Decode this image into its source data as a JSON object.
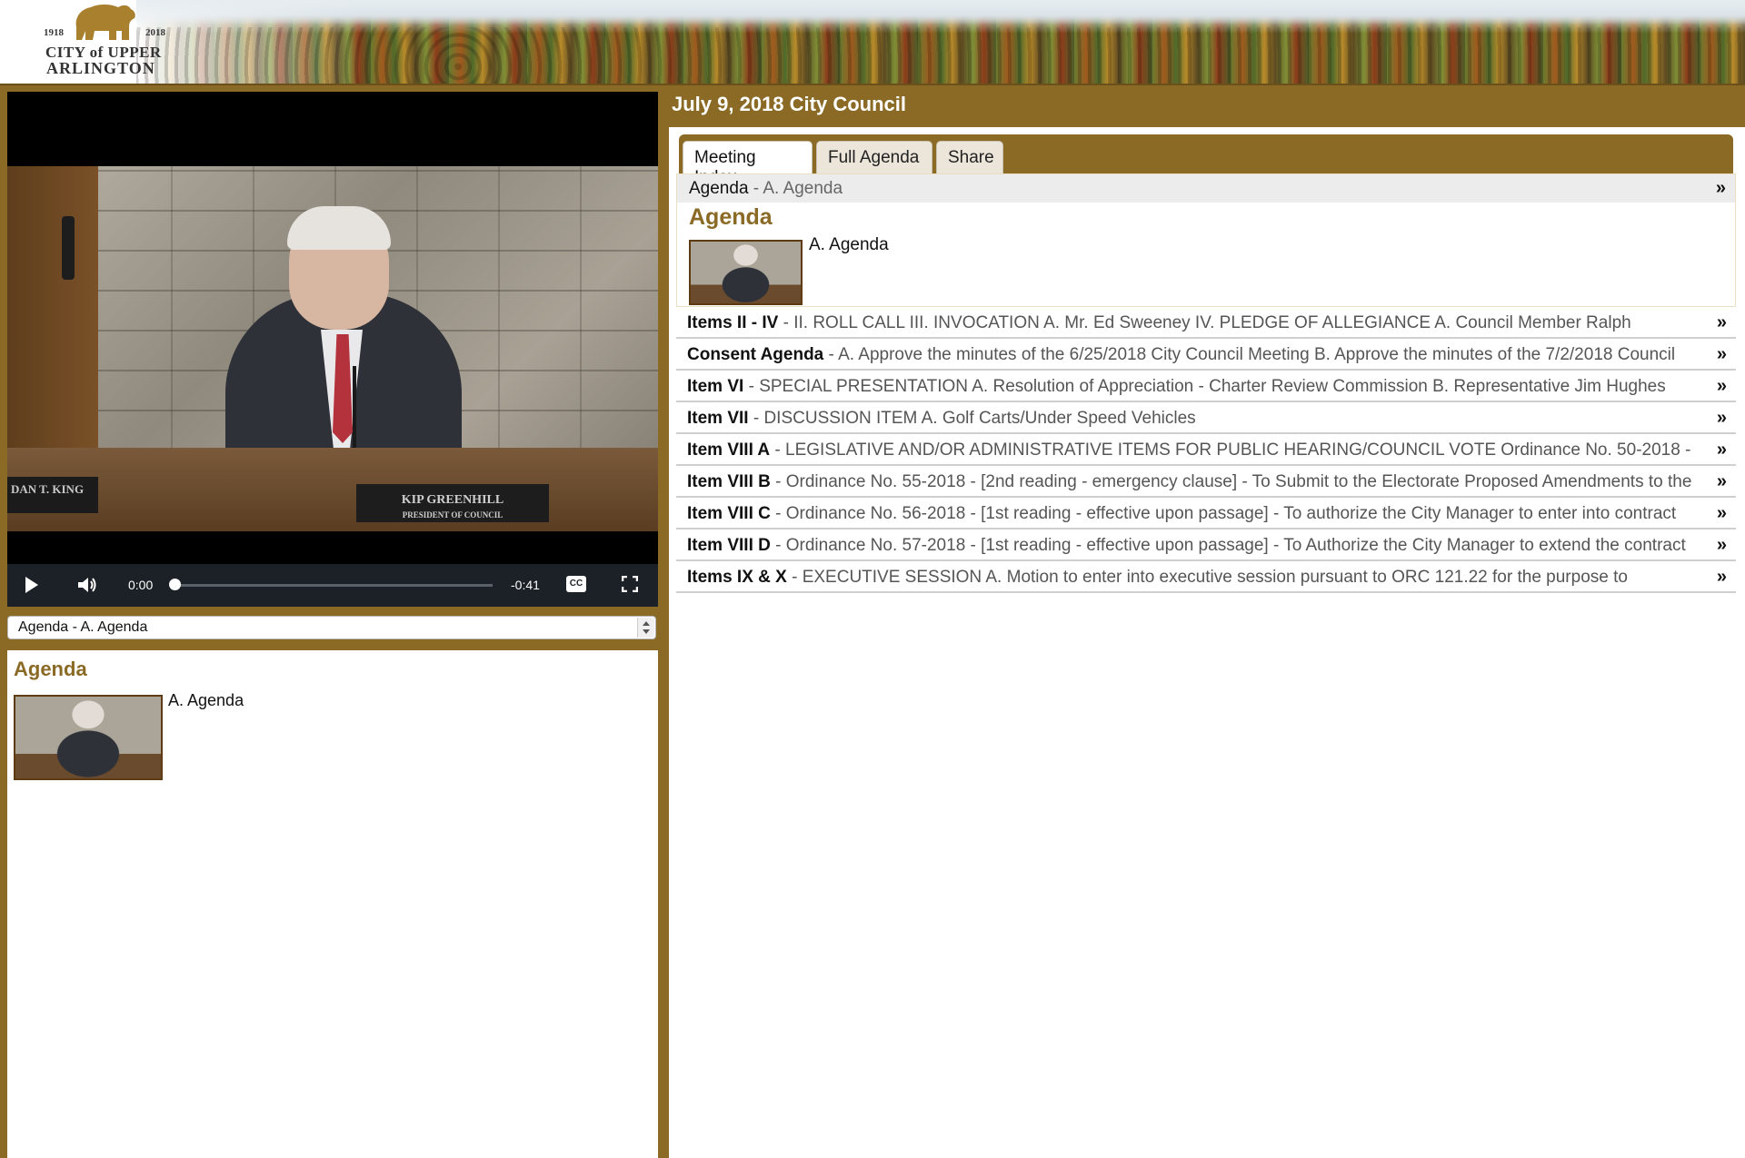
{
  "header": {
    "logo_year_start": "1918",
    "logo_year_end": "2018",
    "logo_line1": "CITY of UPPER",
    "logo_line2": "ARLINGTON"
  },
  "player": {
    "nameplate_left": "DAN T. KING",
    "nameplate_right": "KIP GREENHILL",
    "nameplate_right_sub": "PRESIDENT OF COUNCIL",
    "time_current": "0:00",
    "time_remaining": "-0:41",
    "cc_label": "CC",
    "progress": 0
  },
  "chapter_select": {
    "value": "Agenda - A. Agenda"
  },
  "left_detail": {
    "title": "Agenda",
    "label": "A. Agenda"
  },
  "meeting": {
    "title": "July 9, 2018 City Council"
  },
  "tabs": [
    {
      "label": "Meeting Index",
      "active": true
    },
    {
      "label": "Full Agenda",
      "active": false
    },
    {
      "label": "Share",
      "active": false
    }
  ],
  "active_item": {
    "head_title": "Agenda",
    "head_desc": " - A. Agenda",
    "arrow": "»",
    "title": "Agenda",
    "label": "A. Agenda"
  },
  "index_items": [
    {
      "title": "Items II - IV",
      "desc": " - II. ROLL CALL III. INVOCATION A. Mr. Ed Sweeney IV. PLEDGE OF ALLEGIANCE A. Council Member Ralph",
      "arrow": "»"
    },
    {
      "title": "Consent Agenda",
      "desc": " - A. Approve the minutes of the 6/25/2018 City Council Meeting B. Approve the minutes of the 7/2/2018 Council",
      "arrow": "»"
    },
    {
      "title": "Item VI",
      "desc": " - SPECIAL PRESENTATION A. Resolution of Appreciation - Charter Review Commission B. Representative Jim Hughes",
      "arrow": "»"
    },
    {
      "title": "Item VII",
      "desc": " - DISCUSSION ITEM A. Golf Carts/Under Speed Vehicles",
      "arrow": "»"
    },
    {
      "title": "Item VIII A",
      "desc": " - LEGISLATIVE AND/OR ADMINISTRATIVE ITEMS FOR PUBLIC HEARING/COUNCIL VOTE Ordinance No. 50-2018 -",
      "arrow": "»"
    },
    {
      "title": "Item VIII B",
      "desc": " - Ordinance No. 55-2018 - [2nd reading - emergency clause] - To Submit to the Electorate Proposed Amendments to the",
      "arrow": "»"
    },
    {
      "title": "Item VIII C",
      "desc": " - Ordinance No. 56-2018 - [1st reading - effective upon passage] - To authorize the City Manager to enter into contract",
      "arrow": "»"
    },
    {
      "title": "Item VIII D",
      "desc": " - Ordinance No. 57-2018 - [1st reading - effective upon passage] - To Authorize the City Manager to extend the contract",
      "arrow": "»"
    },
    {
      "title": "Items IX & X",
      "desc": " - EXECUTIVE SESSION A. Motion to enter into executive session pursuant to ORC 121.22 for the purpose to",
      "arrow": "»"
    }
  ]
}
